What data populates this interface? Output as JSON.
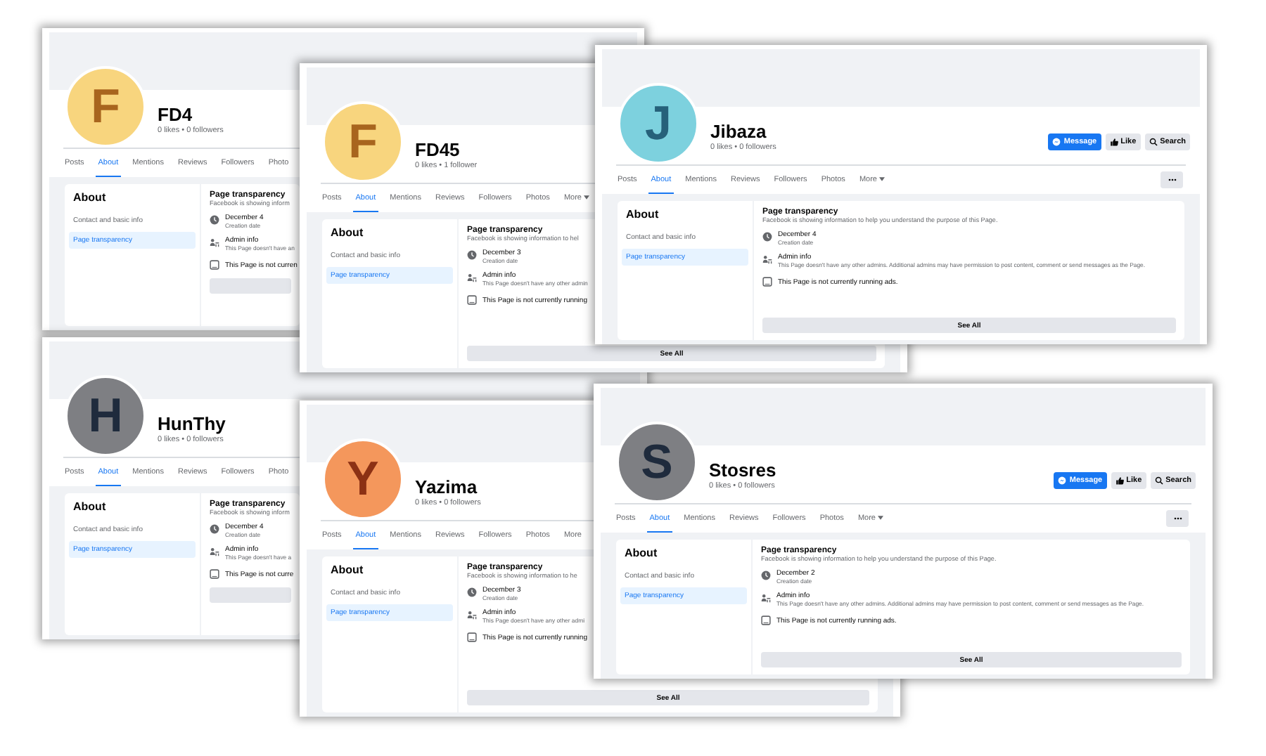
{
  "pages": [
    {
      "name": "FD4",
      "stats": "0 likes • 0 followers",
      "avatar": {
        "color": "#f8d57e",
        "glyph": {
          "text": "F",
          "color": "#a8651e"
        }
      },
      "tabs": [
        {
          "label": "Posts",
          "selected": false,
          "dropdown": false
        },
        {
          "label": "About",
          "selected": true,
          "dropdown": false
        },
        {
          "label": "Mentions",
          "selected": false,
          "dropdown": false
        },
        {
          "label": "Reviews",
          "selected": false,
          "dropdown": false
        },
        {
          "label": "Followers",
          "selected": false,
          "dropdown": false
        },
        {
          "label": "Photo",
          "selected": false,
          "dropdown": false
        }
      ],
      "about": {
        "heading": "About",
        "items": [
          {
            "label": "Contact and basic info",
            "selected": false
          },
          {
            "label": "Page transparency",
            "selected": true
          }
        ]
      },
      "transparency": {
        "title": "Page transparency",
        "subtitle": "Facebook is showing inform",
        "facts": [
          {
            "kind": "date",
            "title": "December 4",
            "detail": "Creation date"
          },
          {
            "kind": "admin",
            "title": "Admin info",
            "detail": "This Page doesn't have an"
          },
          {
            "kind": "ads",
            "title": "This Page is not curren"
          }
        ]
      }
    },
    {
      "name": "HunThy",
      "stats": "0 likes • 0 followers",
      "avatar": {
        "color": "#7e7f83",
        "glyph": {
          "text": "H",
          "color": "#1f2b3d"
        }
      },
      "tabs": [
        {
          "label": "Posts",
          "selected": false,
          "dropdown": false
        },
        {
          "label": "About",
          "selected": true,
          "dropdown": false
        },
        {
          "label": "Mentions",
          "selected": false,
          "dropdown": false
        },
        {
          "label": "Reviews",
          "selected": false,
          "dropdown": false
        },
        {
          "label": "Followers",
          "selected": false,
          "dropdown": false
        },
        {
          "label": "Photo",
          "selected": false,
          "dropdown": false
        }
      ],
      "about": {
        "heading": "About",
        "items": [
          {
            "label": "Contact and basic info",
            "selected": false
          },
          {
            "label": "Page transparency",
            "selected": true
          }
        ]
      },
      "transparency": {
        "title": "Page transparency",
        "subtitle": "Facebook is showing inform",
        "facts": [
          {
            "kind": "date",
            "title": "December 4",
            "detail": "Creation date"
          },
          {
            "kind": "admin",
            "title": "Admin info",
            "detail": "This Page doesn't have a"
          },
          {
            "kind": "ads",
            "title": "This Page is not curre"
          }
        ]
      }
    },
    {
      "name": "FD45",
      "stats": "0 likes • 1 follower",
      "avatar": {
        "color": "#f8d57e",
        "glyph": {
          "text": "F",
          "color": "#a8651e"
        }
      },
      "tabs": [
        {
          "label": "Posts",
          "selected": false,
          "dropdown": false
        },
        {
          "label": "About",
          "selected": true,
          "dropdown": false
        },
        {
          "label": "Mentions",
          "selected": false,
          "dropdown": false
        },
        {
          "label": "Reviews",
          "selected": false,
          "dropdown": false
        },
        {
          "label": "Followers",
          "selected": false,
          "dropdown": false
        },
        {
          "label": "Photos",
          "selected": false,
          "dropdown": false
        },
        {
          "label": "More",
          "selected": false,
          "dropdown": true
        }
      ],
      "about": {
        "heading": "About",
        "items": [
          {
            "label": "Contact and basic info",
            "selected": false
          },
          {
            "label": "Page transparency",
            "selected": true
          }
        ]
      },
      "transparency": {
        "title": "Page transparency",
        "subtitle": "Facebook is showing information to hel",
        "facts": [
          {
            "kind": "date",
            "title": "December 3",
            "detail": "Creation date"
          },
          {
            "kind": "admin",
            "title": "Admin info",
            "detail": "This Page doesn't have any other admin"
          },
          {
            "kind": "ads",
            "title": "This Page is not currently running"
          }
        ],
        "see_all": "See All"
      }
    },
    {
      "name": "Yazima",
      "stats": "0 likes • 0 followers",
      "avatar": {
        "color": "#f4975c",
        "glyph": {
          "text": "Y",
          "color": "#8c3114"
        }
      },
      "tabs": [
        {
          "label": "Posts",
          "selected": false,
          "dropdown": false
        },
        {
          "label": "About",
          "selected": true,
          "dropdown": false
        },
        {
          "label": "Mentions",
          "selected": false,
          "dropdown": false
        },
        {
          "label": "Reviews",
          "selected": false,
          "dropdown": false
        },
        {
          "label": "Followers",
          "selected": false,
          "dropdown": false
        },
        {
          "label": "Photos",
          "selected": false,
          "dropdown": false
        },
        {
          "label": "More",
          "selected": false,
          "dropdown": false
        }
      ],
      "about": {
        "heading": "About",
        "items": [
          {
            "label": "Contact and basic info",
            "selected": false
          },
          {
            "label": "Page transparency",
            "selected": true
          }
        ]
      },
      "transparency": {
        "title": "Page transparency",
        "subtitle": "Facebook is showing information to he",
        "facts": [
          {
            "kind": "date",
            "title": "December 3",
            "detail": "Creation date"
          },
          {
            "kind": "admin",
            "title": "Admin info",
            "detail": "This Page doesn't have any other admi"
          },
          {
            "kind": "ads",
            "title": "This Page is not currently running"
          }
        ],
        "see_all": "See All"
      }
    },
    {
      "name": "Jibaza",
      "stats": "0 likes • 0 followers",
      "avatar": {
        "color": "#7dd1de",
        "glyph": {
          "text": "J",
          "color": "#26617a"
        }
      },
      "actions": [
        {
          "label": "Message",
          "kind": "message"
        },
        {
          "label": "Like",
          "kind": "like"
        },
        {
          "label": "Search",
          "kind": "search"
        }
      ],
      "menu_button": true,
      "tabs": [
        {
          "label": "Posts",
          "selected": false,
          "dropdown": false
        },
        {
          "label": "About",
          "selected": true,
          "dropdown": false
        },
        {
          "label": "Mentions",
          "selected": false,
          "dropdown": false
        },
        {
          "label": "Reviews",
          "selected": false,
          "dropdown": false
        },
        {
          "label": "Followers",
          "selected": false,
          "dropdown": false
        },
        {
          "label": "Photos",
          "selected": false,
          "dropdown": false
        },
        {
          "label": "More",
          "selected": false,
          "dropdown": true
        }
      ],
      "about": {
        "heading": "About",
        "items": [
          {
            "label": "Contact and basic info",
            "selected": false
          },
          {
            "label": "Page transparency",
            "selected": true
          }
        ]
      },
      "transparency": {
        "title": "Page transparency",
        "subtitle": "Facebook is showing information to help you understand the purpose of this Page.",
        "facts": [
          {
            "kind": "date",
            "title": "December 4",
            "detail": "Creation date"
          },
          {
            "kind": "admin",
            "title": "Admin info",
            "detail": "This Page doesn't have any other admins. Additional admins may have permission to post content, comment or send messages as the Page."
          },
          {
            "kind": "ads",
            "title": "This Page is not currently running ads."
          }
        ],
        "see_all": "See All"
      }
    },
    {
      "name": "Stosres",
      "stats": "0 likes • 0 followers",
      "avatar": {
        "color": "#7e7f83",
        "glyph": {
          "text": "S",
          "color": "#1f2b3d"
        }
      },
      "actions": [
        {
          "label": "Message",
          "kind": "message"
        },
        {
          "label": "Like",
          "kind": "like"
        },
        {
          "label": "Search",
          "kind": "search"
        }
      ],
      "menu_button": true,
      "tabs": [
        {
          "label": "Posts",
          "selected": false,
          "dropdown": false
        },
        {
          "label": "About",
          "selected": true,
          "dropdown": false
        },
        {
          "label": "Mentions",
          "selected": false,
          "dropdown": false
        },
        {
          "label": "Reviews",
          "selected": false,
          "dropdown": false
        },
        {
          "label": "Followers",
          "selected": false,
          "dropdown": false
        },
        {
          "label": "Photos",
          "selected": false,
          "dropdown": false
        },
        {
          "label": "More",
          "selected": false,
          "dropdown": true
        }
      ],
      "about": {
        "heading": "About",
        "items": [
          {
            "label": "Contact and basic info",
            "selected": false
          },
          {
            "label": "Page transparency",
            "selected": true
          }
        ]
      },
      "transparency": {
        "title": "Page transparency",
        "subtitle": "Facebook is showing information to help you understand the purpose of this Page.",
        "facts": [
          {
            "kind": "date",
            "title": "December 2",
            "detail": "Creation date"
          },
          {
            "kind": "admin",
            "title": "Admin info",
            "detail": "This Page doesn't have any other admins. Additional admins may have permission to post content, comment or send messages as the Page."
          },
          {
            "kind": "ads",
            "title": "This Page is not currently running ads."
          }
        ],
        "see_all": "See All"
      }
    }
  ]
}
